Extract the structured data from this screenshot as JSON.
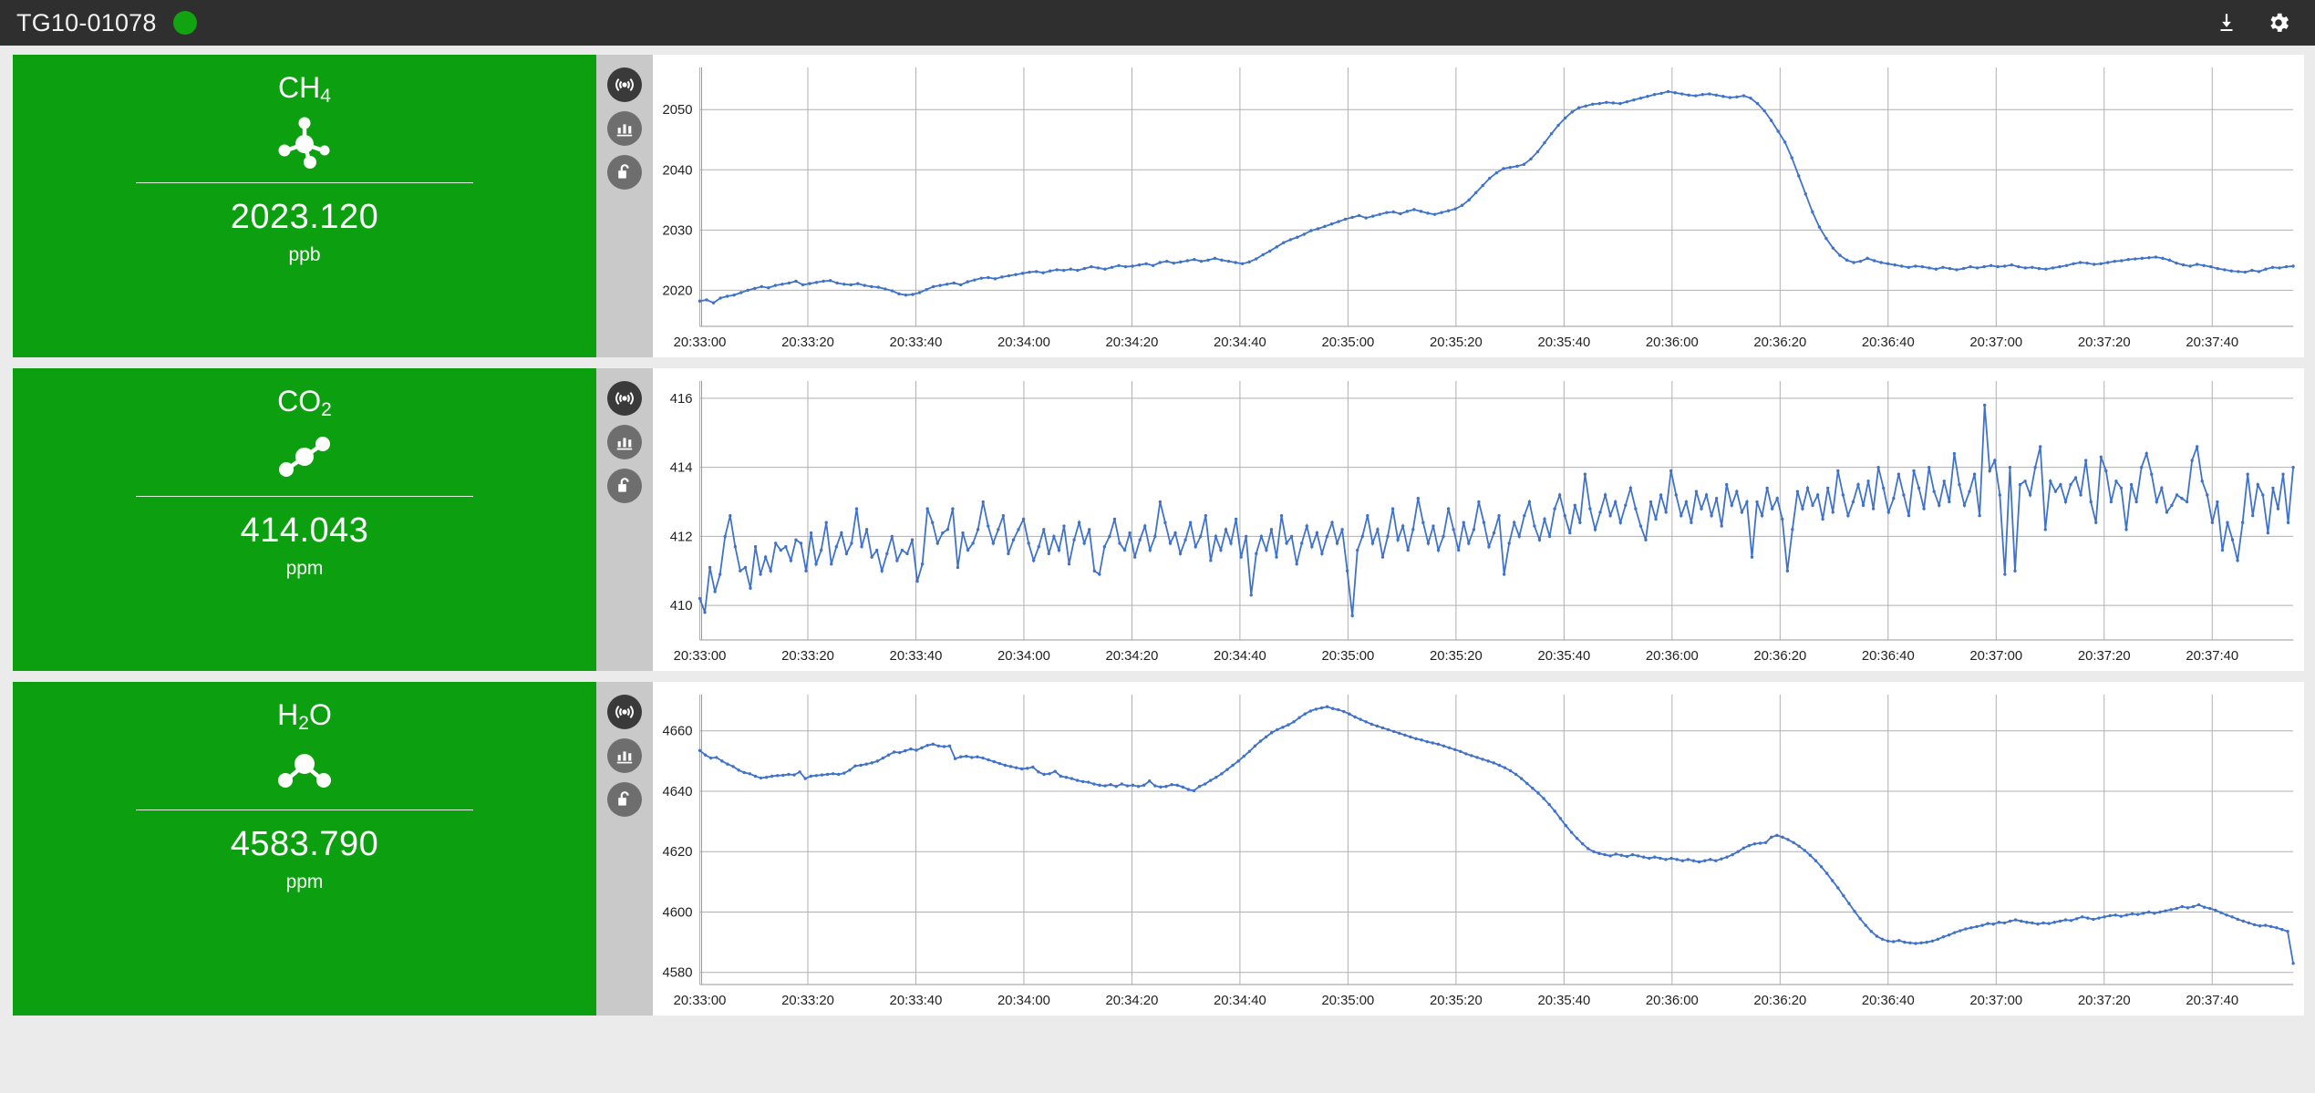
{
  "topbar": {
    "device_id": "TG10-01078",
    "status_color": "#11a310",
    "download_icon": "download-icon",
    "settings_icon": "gear-icon"
  },
  "rail": {
    "broadcast_label": "broadcast-icon",
    "chart_label": "bar-chart-icon",
    "lock_label": "unlock-icon"
  },
  "panels": [
    {
      "gas": "CH",
      "subscript": "4",
      "molecule": "methane-molecule-icon",
      "value": "2023.120",
      "unit": "ppb",
      "card_color": "#0ca010"
    },
    {
      "gas": "CO",
      "subscript": "2",
      "molecule": "carbon-dioxide-molecule-icon",
      "value": "414.043",
      "unit": "ppm",
      "card_color": "#0ca010"
    },
    {
      "gas": "H",
      "subscript": "2",
      "gas_tail": "O",
      "molecule": "water-molecule-icon",
      "value": "4583.790",
      "unit": "ppm",
      "card_color": "#0ca010"
    }
  ],
  "chart_data": [
    {
      "type": "line",
      "title": "CH4",
      "ylabel": "ppb",
      "xlabel": "",
      "ylim": [
        2014,
        2057
      ],
      "yticks": [
        2020,
        2030,
        2040,
        2050
      ],
      "xticks": [
        "20:33:00",
        "20:33:20",
        "20:33:40",
        "20:34:00",
        "20:34:20",
        "20:34:40",
        "20:35:00",
        "20:35:20",
        "20:35:40",
        "20:36:00",
        "20:36:20",
        "20:36:40",
        "20:37:00",
        "20:37:20",
        "20:37:40"
      ],
      "x_start": "20:33:00",
      "x_end": "20:37:55",
      "grid": true,
      "legend": "none",
      "color": "#3f72c8",
      "values": [
        2018.2,
        2018.4,
        2017.9,
        2018.7,
        2019.0,
        2019.2,
        2019.6,
        2020.0,
        2020.3,
        2020.6,
        2020.4,
        2020.8,
        2021.0,
        2021.2,
        2021.5,
        2020.9,
        2021.1,
        2021.3,
        2021.5,
        2021.6,
        2021.2,
        2021.0,
        2020.9,
        2021.1,
        2020.8,
        2020.6,
        2020.5,
        2020.2,
        2019.9,
        2019.4,
        2019.2,
        2019.3,
        2019.6,
        2020.1,
        2020.6,
        2020.8,
        2021.0,
        2021.2,
        2020.9,
        2021.4,
        2021.7,
        2022.0,
        2022.1,
        2021.9,
        2022.2,
        2022.4,
        2022.6,
        2022.8,
        2023.0,
        2023.1,
        2022.9,
        2023.2,
        2023.4,
        2023.3,
        2023.5,
        2023.3,
        2023.6,
        2023.9,
        2023.7,
        2023.5,
        2023.8,
        2024.1,
        2023.9,
        2024.0,
        2024.2,
        2024.4,
        2024.1,
        2024.6,
        2024.8,
        2024.5,
        2024.7,
        2024.9,
        2025.1,
        2024.8,
        2025.0,
        2025.3,
        2025.0,
        2024.8,
        2024.6,
        2024.4,
        2024.7,
        2025.2,
        2025.9,
        2026.5,
        2027.2,
        2027.9,
        2028.4,
        2028.8,
        2029.3,
        2029.9,
        2030.2,
        2030.6,
        2031.0,
        2031.4,
        2031.8,
        2032.1,
        2032.4,
        2032.0,
        2032.3,
        2032.6,
        2032.9,
        2033.0,
        2032.7,
        2033.1,
        2033.4,
        2033.1,
        2032.8,
        2032.6,
        2032.9,
        2033.2,
        2033.5,
        2034.1,
        2035.0,
        2036.2,
        2037.4,
        2038.6,
        2039.5,
        2040.2,
        2040.4,
        2040.6,
        2040.9,
        2041.8,
        2043.0,
        2044.5,
        2046.0,
        2047.4,
        2048.6,
        2049.6,
        2050.3,
        2050.6,
        2050.9,
        2051.0,
        2051.2,
        2051.1,
        2051.0,
        2051.3,
        2051.6,
        2051.9,
        2052.2,
        2052.5,
        2052.7,
        2053.0,
        2052.8,
        2052.6,
        2052.4,
        2052.3,
        2052.5,
        2052.6,
        2052.4,
        2052.2,
        2052.0,
        2052.1,
        2052.3,
        2051.9,
        2051.0,
        2049.8,
        2048.2,
        2046.4,
        2044.6,
        2042.0,
        2039.0,
        2036.0,
        2033.0,
        2030.5,
        2028.6,
        2027.0,
        2025.8,
        2025.0,
        2024.6,
        2024.8,
        2025.3,
        2024.9,
        2024.6,
        2024.4,
        2024.2,
        2024.0,
        2023.8,
        2024.0,
        2023.9,
        2023.7,
        2023.5,
        2023.8,
        2023.6,
        2023.4,
        2023.6,
        2023.9,
        2023.7,
        2023.9,
        2024.1,
        2023.9,
        2024.0,
        2024.2,
        2023.9,
        2023.7,
        2023.8,
        2023.6,
        2023.5,
        2023.7,
        2023.9,
        2024.1,
        2024.4,
        2024.6,
        2024.5,
        2024.3,
        2024.4,
        2024.6,
        2024.8,
        2024.9,
        2025.1,
        2025.2,
        2025.3,
        2025.4,
        2025.5,
        2025.3,
        2025.0,
        2024.5,
        2024.2,
        2024.0,
        2024.3,
        2024.1,
        2023.9,
        2023.6,
        2023.4,
        2023.2,
        2023.1,
        2023.0,
        2023.3,
        2023.1,
        2023.5,
        2023.8,
        2023.7,
        2023.9,
        2024.0
      ]
    },
    {
      "type": "line",
      "title": "CO2",
      "ylabel": "ppm",
      "xlabel": "",
      "ylim": [
        409.0,
        416.5
      ],
      "yticks": [
        410,
        412,
        414,
        416
      ],
      "xticks": [
        "20:33:00",
        "20:33:20",
        "20:33:40",
        "20:34:00",
        "20:34:20",
        "20:34:40",
        "20:35:00",
        "20:35:20",
        "20:35:40",
        "20:36:00",
        "20:36:20",
        "20:36:40",
        "20:37:00",
        "20:37:20",
        "20:37:40"
      ],
      "x_start": "20:33:00",
      "x_end": "20:37:55",
      "grid": true,
      "legend": "none",
      "color": "#3f72c8",
      "values": [
        410.2,
        409.8,
        411.1,
        410.4,
        410.9,
        412.0,
        412.6,
        411.7,
        411.0,
        411.1,
        410.5,
        411.7,
        410.9,
        411.4,
        411.0,
        411.8,
        411.6,
        411.7,
        411.3,
        411.9,
        411.8,
        411.0,
        412.1,
        411.2,
        411.6,
        412.4,
        411.2,
        411.7,
        412.1,
        411.5,
        411.8,
        412.8,
        411.7,
        412.2,
        411.4,
        411.6,
        411.0,
        411.5,
        412.0,
        411.3,
        411.6,
        411.5,
        411.9,
        410.7,
        411.2,
        412.8,
        412.4,
        411.8,
        412.1,
        412.2,
        412.8,
        411.1,
        412.1,
        411.6,
        411.8,
        412.2,
        413.0,
        412.3,
        411.8,
        412.2,
        412.6,
        411.5,
        411.9,
        412.2,
        412.5,
        411.8,
        411.3,
        411.7,
        412.2,
        411.5,
        412.0,
        411.6,
        412.3,
        411.2,
        411.9,
        412.4,
        411.8,
        412.2,
        411.0,
        410.9,
        411.7,
        412.0,
        412.5,
        411.8,
        411.6,
        412.1,
        411.4,
        411.9,
        412.3,
        411.6,
        412.0,
        413.0,
        412.4,
        411.8,
        412.1,
        411.5,
        411.9,
        412.4,
        411.7,
        412.0,
        412.6,
        411.3,
        412.0,
        411.6,
        412.2,
        411.8,
        412.5,
        411.4,
        412.0,
        410.3,
        411.5,
        412.0,
        411.6,
        412.2,
        411.4,
        412.6,
        411.8,
        412.0,
        411.2,
        411.8,
        412.3,
        411.7,
        412.1,
        411.5,
        412.0,
        412.4,
        411.8,
        412.2,
        411.0,
        409.7,
        411.6,
        412.0,
        412.6,
        411.8,
        412.2,
        411.4,
        412.0,
        412.8,
        411.9,
        412.3,
        411.6,
        412.2,
        413.1,
        412.4,
        411.8,
        412.3,
        411.6,
        412.0,
        412.8,
        412.2,
        411.6,
        412.4,
        411.8,
        412.2,
        413.0,
        412.4,
        411.7,
        412.1,
        412.6,
        410.9,
        411.8,
        412.4,
        412.0,
        412.6,
        413.0,
        412.3,
        411.9,
        412.5,
        412.0,
        412.8,
        413.2,
        412.6,
        412.1,
        412.9,
        412.4,
        413.8,
        412.8,
        412.2,
        412.7,
        413.2,
        412.6,
        413.0,
        412.4,
        412.9,
        413.4,
        412.8,
        412.3,
        411.9,
        413.0,
        412.5,
        413.2,
        412.7,
        413.9,
        413.2,
        412.6,
        413.0,
        412.4,
        413.3,
        412.8,
        413.2,
        412.6,
        413.1,
        412.3,
        413.5,
        412.9,
        413.3,
        412.7,
        413.0,
        411.4,
        413.0,
        412.6,
        413.4,
        412.8,
        413.1,
        412.5,
        411.0,
        412.2,
        413.3,
        412.8,
        413.4,
        412.9,
        413.2,
        412.5,
        413.4,
        412.7,
        413.9,
        413.2,
        412.6,
        413.0,
        413.5,
        412.9,
        413.6,
        412.8,
        414.0,
        413.4,
        412.7,
        413.1,
        413.8,
        413.2,
        412.6,
        413.9,
        413.4,
        412.8,
        414.0,
        413.3,
        412.9,
        413.6,
        413.0,
        414.4,
        413.5,
        412.9,
        413.3,
        413.8,
        412.6,
        415.8,
        413.9,
        414.2,
        413.2,
        410.9,
        414.0,
        411.0,
        413.5,
        413.6,
        413.2,
        414.0,
        414.6,
        412.2,
        413.6,
        413.3,
        413.5,
        413.0,
        413.5,
        413.7,
        413.2,
        414.2,
        413.0,
        412.4,
        414.3,
        413.9,
        413.0,
        413.6,
        413.4,
        412.2,
        413.5,
        413.0,
        414.0,
        414.4,
        413.8,
        413.0,
        413.4,
        412.7,
        412.9,
        413.2,
        413.1,
        413.0,
        414.2,
        414.6,
        413.6,
        413.2,
        412.4,
        413.0,
        411.6,
        412.4,
        411.9,
        411.3,
        412.4,
        413.8,
        412.6,
        413.5,
        413.2,
        412.1,
        413.4,
        412.8,
        413.8,
        412.4,
        414.0
      ]
    },
    {
      "type": "line",
      "title": "H2O",
      "ylabel": "ppm",
      "xlabel": "",
      "ylim": [
        4576,
        4672
      ],
      "yticks": [
        4580,
        4600,
        4620,
        4640,
        4660
      ],
      "xticks": [
        "20:33:00",
        "20:33:20",
        "20:33:40",
        "20:34:00",
        "20:34:20",
        "20:34:40",
        "20:35:00",
        "20:35:20",
        "20:35:40",
        "20:36:00",
        "20:36:20",
        "20:36:40",
        "20:37:00",
        "20:37:20",
        "20:37:40"
      ],
      "x_start": "20:33:00",
      "x_end": "20:37:55",
      "grid": true,
      "legend": "none",
      "color": "#3f72c8",
      "values": [
        4653.5,
        4652.0,
        4651.0,
        4651.2,
        4650.0,
        4649.0,
        4648.2,
        4647.0,
        4646.2,
        4645.8,
        4645.0,
        4644.4,
        4644.6,
        4645.0,
        4645.2,
        4645.3,
        4645.6,
        4645.4,
        4646.4,
        4644.2,
        4645.0,
        4645.2,
        4645.4,
        4645.6,
        4645.8,
        4645.6,
        4646.0,
        4647.0,
        4648.4,
        4648.6,
        4649.0,
        4649.4,
        4650.0,
        4651.0,
        4652.0,
        4653.0,
        4652.8,
        4653.4,
        4654.0,
        4653.6,
        4654.4,
        4655.2,
        4655.6,
        4655.0,
        4654.8,
        4655.0,
        4650.8,
        4651.4,
        4651.6,
        4651.2,
        4651.4,
        4651.0,
        4650.4,
        4649.8,
        4649.2,
        4648.6,
        4648.2,
        4647.8,
        4647.4,
        4647.6,
        4648.0,
        4646.4,
        4645.6,
        4645.8,
        4646.6,
        4645.0,
        4644.6,
        4644.2,
        4643.6,
        4643.2,
        4643.0,
        4642.4,
        4642.0,
        4641.8,
        4642.2,
        4641.6,
        4642.4,
        4641.8,
        4642.0,
        4641.6,
        4642.0,
        4643.4,
        4641.8,
        4641.4,
        4641.6,
        4642.2,
        4642.0,
        4641.4,
        4640.6,
        4640.2,
        4641.6,
        4642.4,
        4643.6,
        4644.6,
        4645.8,
        4647.2,
        4648.6,
        4650.0,
        4651.6,
        4653.2,
        4655.0,
        4656.6,
        4658.0,
        4659.4,
        4660.4,
        4661.2,
        4662.0,
        4663.0,
        4664.4,
        4665.6,
        4666.6,
        4667.2,
        4667.6,
        4668.0,
        4667.4,
        4667.0,
        4666.4,
        4665.6,
        4664.6,
        4663.8,
        4663.0,
        4662.2,
        4661.6,
        4661.0,
        4660.4,
        4659.8,
        4659.2,
        4658.6,
        4658.0,
        4657.4,
        4657.0,
        4656.4,
        4656.0,
        4655.6,
        4655.0,
        4654.4,
        4653.8,
        4653.2,
        4652.4,
        4651.8,
        4651.2,
        4650.6,
        4650.0,
        4649.4,
        4648.6,
        4647.8,
        4646.8,
        4645.6,
        4644.2,
        4642.6,
        4641.0,
        4639.4,
        4637.6,
        4635.6,
        4633.4,
        4631.0,
        4628.6,
        4626.4,
        4624.4,
        4622.6,
        4621.0,
        4620.0,
        4619.4,
        4619.0,
        4618.6,
        4619.2,
        4618.8,
        4618.4,
        4619.0,
        4618.6,
        4618.2,
        4617.8,
        4618.2,
        4617.8,
        4617.4,
        4617.8,
        4617.4,
        4617.0,
        4617.4,
        4617.0,
        4616.6,
        4617.0,
        4617.4,
        4617.0,
        4617.6,
        4618.2,
        4619.0,
        4620.0,
        4621.2,
        4622.0,
        4622.6,
        4622.8,
        4623.0,
        4624.8,
        4625.4,
        4624.8,
        4624.0,
        4623.0,
        4621.8,
        4620.4,
        4618.8,
        4617.0,
        4615.0,
        4612.8,
        4610.4,
        4608.0,
        4605.4,
        4602.8,
        4600.2,
        4597.8,
        4595.6,
        4593.6,
        4592.0,
        4591.0,
        4590.4,
        4590.2,
        4590.6,
        4590.0,
        4589.8,
        4589.6,
        4589.8,
        4590.0,
        4590.4,
        4591.0,
        4591.8,
        4592.4,
        4593.2,
        4593.8,
        4594.4,
        4594.8,
        4595.2,
        4595.6,
        4596.2,
        4596.0,
        4596.6,
        4596.4,
        4597.0,
        4597.4,
        4597.0,
        4596.6,
        4596.4,
        4596.0,
        4596.4,
        4596.2,
        4596.6,
        4597.0,
        4597.4,
        4597.2,
        4597.8,
        4598.4,
        4598.0,
        4597.6,
        4598.0,
        4598.4,
        4598.8,
        4599.0,
        4598.6,
        4599.0,
        4599.4,
        4599.2,
        4599.6,
        4600.0,
        4599.6,
        4600.0,
        4600.4,
        4600.8,
        4601.2,
        4601.8,
        4601.4,
        4601.8,
        4602.4,
        4601.6,
        4601.2,
        4600.6,
        4599.8,
        4599.0,
        4598.4,
        4597.6,
        4597.0,
        4596.4,
        4595.8,
        4595.4,
        4595.6,
        4595.2,
        4594.8,
        4594.2,
        4593.6,
        4583.0
      ]
    }
  ]
}
